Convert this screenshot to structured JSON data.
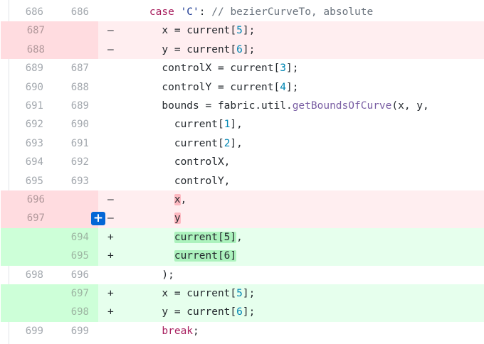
{
  "diff": {
    "add_comment_icon": "plus-icon",
    "colors": {
      "deletion_bg": "#ffeef0",
      "addition_bg": "#e6ffed",
      "keyword": "#a71d5d",
      "string": "#183691",
      "number": "#0086b3",
      "function": "#795da3",
      "comment": "#6a737d"
    },
    "rows": [
      {
        "type": "ctx",
        "old": "686",
        "new": "686",
        "marker": "",
        "tokens": [
          [
            "p",
            "    "
          ],
          [
            "kw",
            "case"
          ],
          [
            "p",
            " "
          ],
          [
            "str",
            "'C'"
          ],
          [
            "p",
            ": "
          ],
          [
            "cmt",
            "// bezierCurveTo, absolute"
          ]
        ]
      },
      {
        "type": "del",
        "old": "687",
        "new": "",
        "marker": "-",
        "tokens": [
          [
            "p",
            "      x = current["
          ],
          [
            "n",
            "5"
          ],
          [
            "p",
            "];"
          ]
        ]
      },
      {
        "type": "del",
        "old": "688",
        "new": "",
        "marker": "-",
        "tokens": [
          [
            "p",
            "      y = current["
          ],
          [
            "n",
            "6"
          ],
          [
            "p",
            "];"
          ]
        ]
      },
      {
        "type": "ctx",
        "old": "689",
        "new": "687",
        "marker": "",
        "tokens": [
          [
            "p",
            "      controlX = current["
          ],
          [
            "n",
            "3"
          ],
          [
            "p",
            "];"
          ]
        ]
      },
      {
        "type": "ctx",
        "old": "690",
        "new": "688",
        "marker": "",
        "tokens": [
          [
            "p",
            "      controlY = current["
          ],
          [
            "n",
            "4"
          ],
          [
            "p",
            "];"
          ]
        ]
      },
      {
        "type": "ctx",
        "old": "691",
        "new": "689",
        "marker": "",
        "tokens": [
          [
            "p",
            "      bounds = fabric.util."
          ],
          [
            "fn",
            "getBoundsOfCurve"
          ],
          [
            "p",
            "(x, y,"
          ]
        ]
      },
      {
        "type": "ctx",
        "old": "692",
        "new": "690",
        "marker": "",
        "tokens": [
          [
            "p",
            "        current["
          ],
          [
            "n",
            "1"
          ],
          [
            "p",
            "],"
          ]
        ]
      },
      {
        "type": "ctx",
        "old": "693",
        "new": "691",
        "marker": "",
        "tokens": [
          [
            "p",
            "        current["
          ],
          [
            "n",
            "2"
          ],
          [
            "p",
            "],"
          ]
        ]
      },
      {
        "type": "ctx",
        "old": "694",
        "new": "692",
        "marker": "",
        "tokens": [
          [
            "p",
            "        controlX,"
          ]
        ]
      },
      {
        "type": "ctx",
        "old": "695",
        "new": "693",
        "marker": "",
        "tokens": [
          [
            "p",
            "        controlY,"
          ]
        ]
      },
      {
        "type": "del",
        "old": "696",
        "new": "",
        "marker": "-",
        "tokens": [
          [
            "p",
            "        "
          ],
          [
            "hd",
            "x"
          ],
          [
            "p",
            ","
          ]
        ]
      },
      {
        "type": "del",
        "old": "697",
        "new": "",
        "marker": "-",
        "tokens": [
          [
            "p",
            "        "
          ],
          [
            "hd",
            "y"
          ]
        ]
      },
      {
        "type": "add",
        "old": "",
        "new": "694",
        "marker": "+",
        "tokens": [
          [
            "p",
            "        "
          ],
          [
            "ha",
            "current[5]"
          ],
          [
            "p",
            ","
          ]
        ]
      },
      {
        "type": "add",
        "old": "",
        "new": "695",
        "marker": "+",
        "tokens": [
          [
            "p",
            "        "
          ],
          [
            "ha",
            "current[6]"
          ]
        ]
      },
      {
        "type": "ctx",
        "old": "698",
        "new": "696",
        "marker": "",
        "tokens": [
          [
            "p",
            "      );"
          ]
        ]
      },
      {
        "type": "add",
        "old": "",
        "new": "697",
        "marker": "+",
        "tokens": [
          [
            "p",
            "      x = current["
          ],
          [
            "n",
            "5"
          ],
          [
            "p",
            "];"
          ]
        ]
      },
      {
        "type": "add",
        "old": "",
        "new": "698",
        "marker": "+",
        "tokens": [
          [
            "p",
            "      y = current["
          ],
          [
            "n",
            "6"
          ],
          [
            "p",
            "];"
          ]
        ]
      },
      {
        "type": "ctx",
        "old": "699",
        "new": "699",
        "marker": "",
        "tokens": [
          [
            "p",
            "      "
          ],
          [
            "kw",
            "break"
          ],
          [
            "p",
            ";"
          ]
        ]
      }
    ]
  }
}
